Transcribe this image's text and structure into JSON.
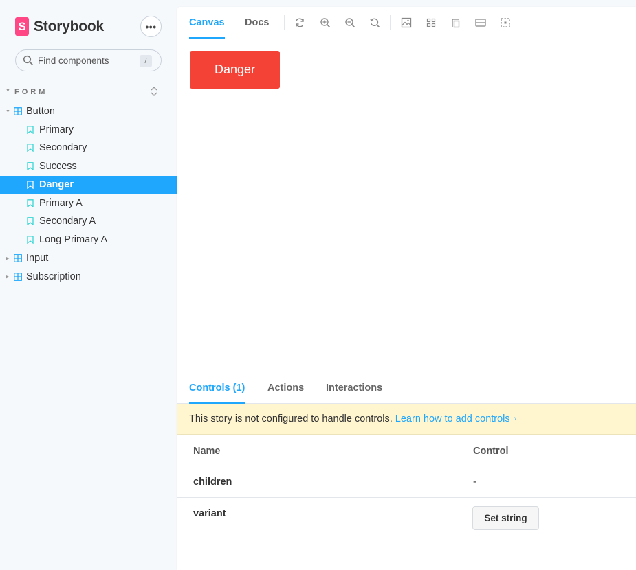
{
  "brand": {
    "logo_letter": "S",
    "name": "Storybook",
    "logo_color": "#ff4785"
  },
  "sidebar": {
    "menu_label": "•••",
    "search": {
      "placeholder": "Find components",
      "shortcut": "/"
    },
    "group": {
      "title": "FORM"
    },
    "tree": [
      {
        "label": "Button",
        "type": "component",
        "expanded": true
      },
      {
        "label": "Primary",
        "type": "story"
      },
      {
        "label": "Secondary",
        "type": "story"
      },
      {
        "label": "Success",
        "type": "story"
      },
      {
        "label": "Danger",
        "type": "story",
        "selected": true
      },
      {
        "label": "Primary A",
        "type": "story"
      },
      {
        "label": "Secondary A",
        "type": "story"
      },
      {
        "label": "Long Primary A",
        "type": "story"
      },
      {
        "label": "Input",
        "type": "component",
        "expanded": false
      },
      {
        "label": "Subscription",
        "type": "component",
        "expanded": false
      }
    ]
  },
  "toolbar": {
    "tabs": [
      {
        "label": "Canvas",
        "active": true
      },
      {
        "label": "Docs",
        "active": false
      }
    ],
    "tools": [
      "reload-icon",
      "zoom-in-icon",
      "zoom-out-icon",
      "reset-zoom-icon",
      "background-icon",
      "grid-icon",
      "viewport-icon",
      "measure-icon",
      "outline-icon"
    ]
  },
  "preview": {
    "button_label": "Danger",
    "button_color": "#f44336"
  },
  "addons": {
    "tabs": [
      {
        "label": "Controls (1)",
        "active": true
      },
      {
        "label": "Actions",
        "active": false
      },
      {
        "label": "Interactions",
        "active": false
      }
    ],
    "notice": {
      "text": "This story is not configured to handle controls.",
      "link": "Learn how to add controls"
    },
    "table": {
      "headers": {
        "name": "Name",
        "control": "Control"
      },
      "rows": [
        {
          "name": "children",
          "control": "-"
        },
        {
          "name": "variant",
          "control_button": "Set string"
        }
      ]
    }
  },
  "colors": {
    "accent": "#1ea7fd",
    "notice_bg": "#fff5cf"
  }
}
